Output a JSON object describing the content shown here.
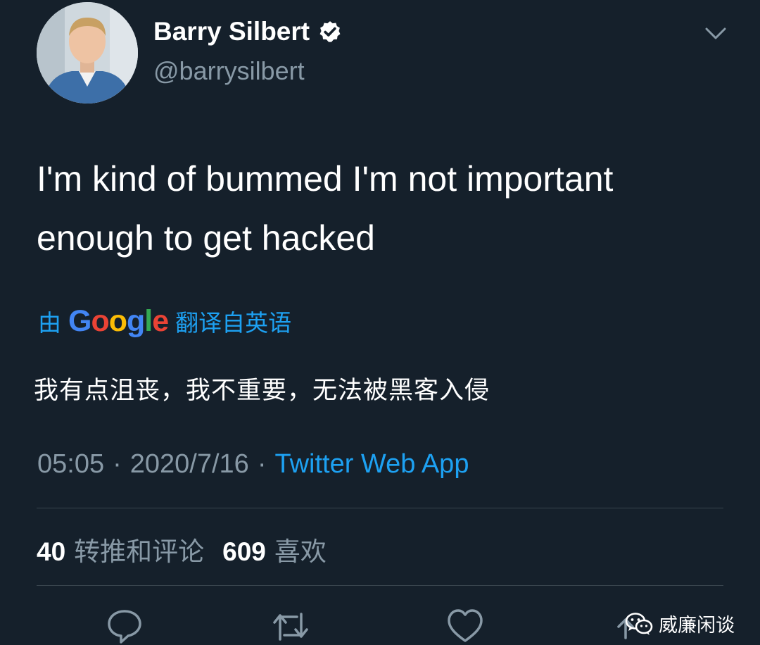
{
  "author": {
    "display_name": "Barry Silbert",
    "handle": "@barrysilbert",
    "verified_icon": "verified-badge-icon",
    "avatar_icon": "profile-photo"
  },
  "tweet": {
    "text_line1": "I'm kind of bummed I'm not important",
    "text_line2": "enough to get hacked"
  },
  "translation": {
    "prefix": "由",
    "provider_letters": [
      "G",
      "o",
      "o",
      "g",
      "l",
      "e"
    ],
    "suffix": "翻译自英语",
    "text": "我有点沮丧，我不重要，无法被黑客入侵"
  },
  "meta": {
    "time": "05:05",
    "separator": "·",
    "date": "2020/7/16",
    "source": "Twitter Web App"
  },
  "stats": {
    "retweets_count": "40",
    "retweets_label": "转推和评论",
    "likes_count": "609",
    "likes_label": "喜欢"
  },
  "actions": [
    "reply-icon",
    "retweet-icon",
    "like-icon",
    "share-icon"
  ],
  "watermark": {
    "text": "威廉闲谈",
    "icon": "wechat-icon"
  },
  "colors": {
    "background": "#15202b",
    "accent": "#1da1f2",
    "secondary_text": "#8899a6"
  }
}
